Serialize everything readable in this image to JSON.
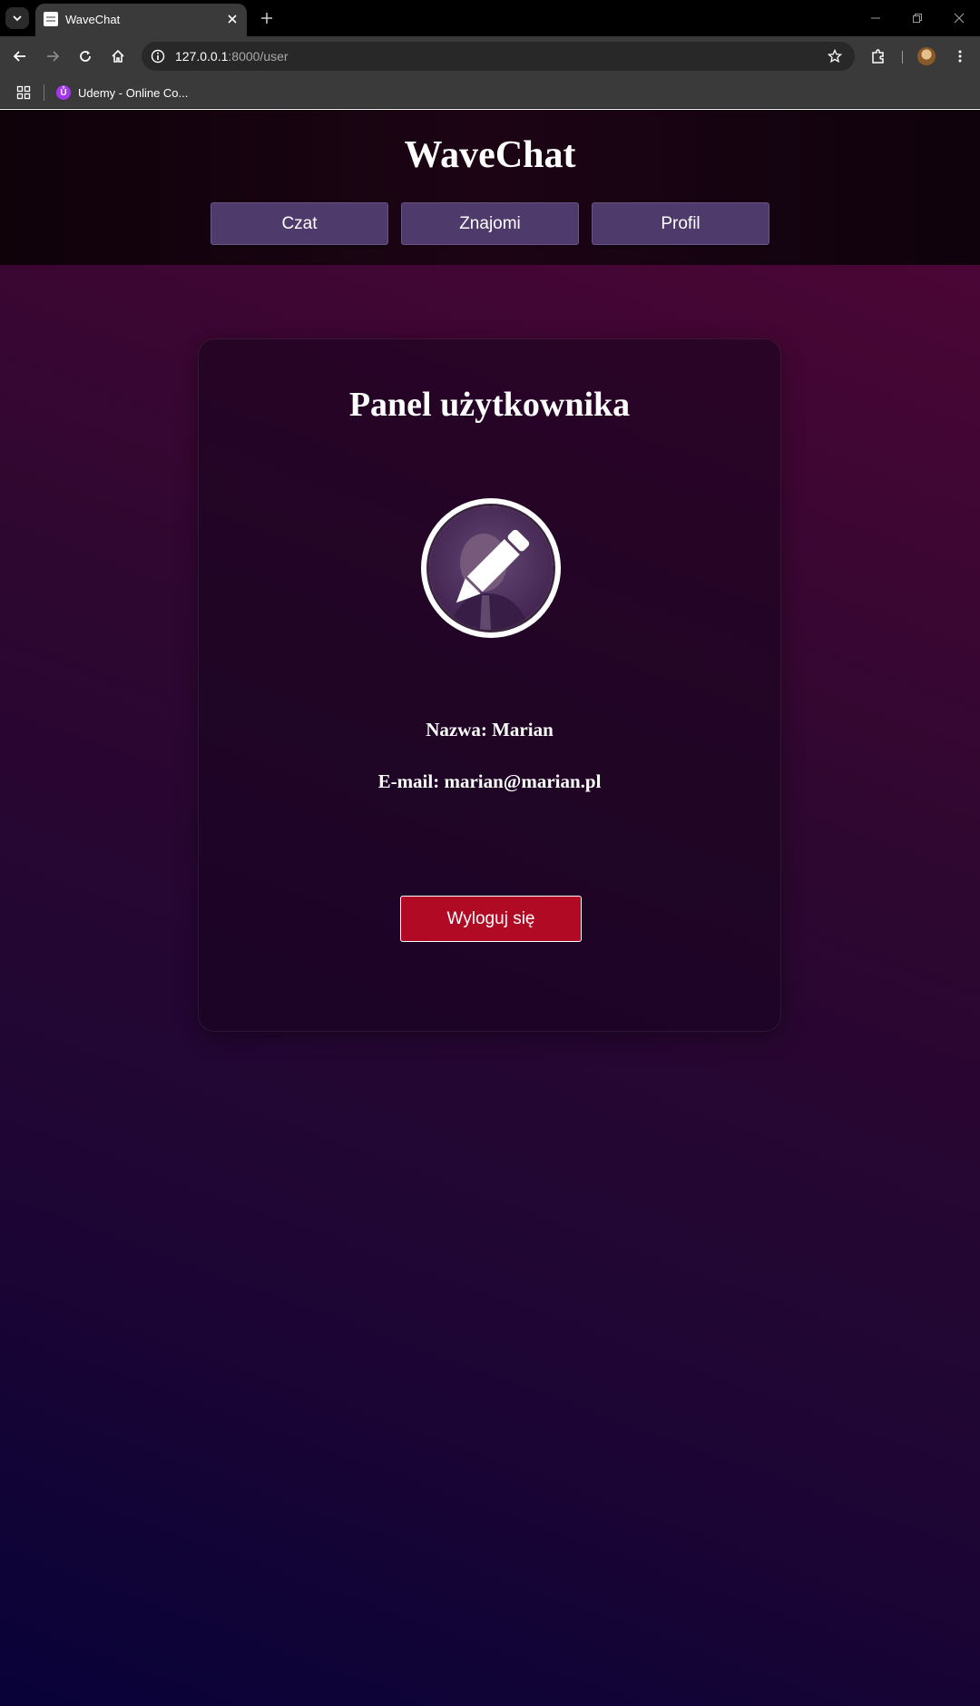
{
  "browser": {
    "tab_title": "WaveChat",
    "url_host": "127.0.0.1",
    "url_rest": ":8000/user",
    "bookmarks": [
      {
        "label": "Udemy - Online Co...",
        "icon": "udemy-icon"
      }
    ]
  },
  "header": {
    "brand": "WaveChat",
    "nav": [
      {
        "label": "Czat"
      },
      {
        "label": "Znajomi"
      },
      {
        "label": "Profil"
      }
    ]
  },
  "panel": {
    "title": "Panel użytkownika",
    "avatar_icon": "pencil-edit-icon",
    "name_label": "Nazwa: Marian",
    "email_label": "E-mail: marian@marian.pl",
    "logout_label": "Wyloguj się"
  },
  "colors": {
    "nav_button": "#4e3a6b",
    "logout_button": "#b10a24",
    "background_top": "#520537",
    "background_bottom": "#080238"
  }
}
